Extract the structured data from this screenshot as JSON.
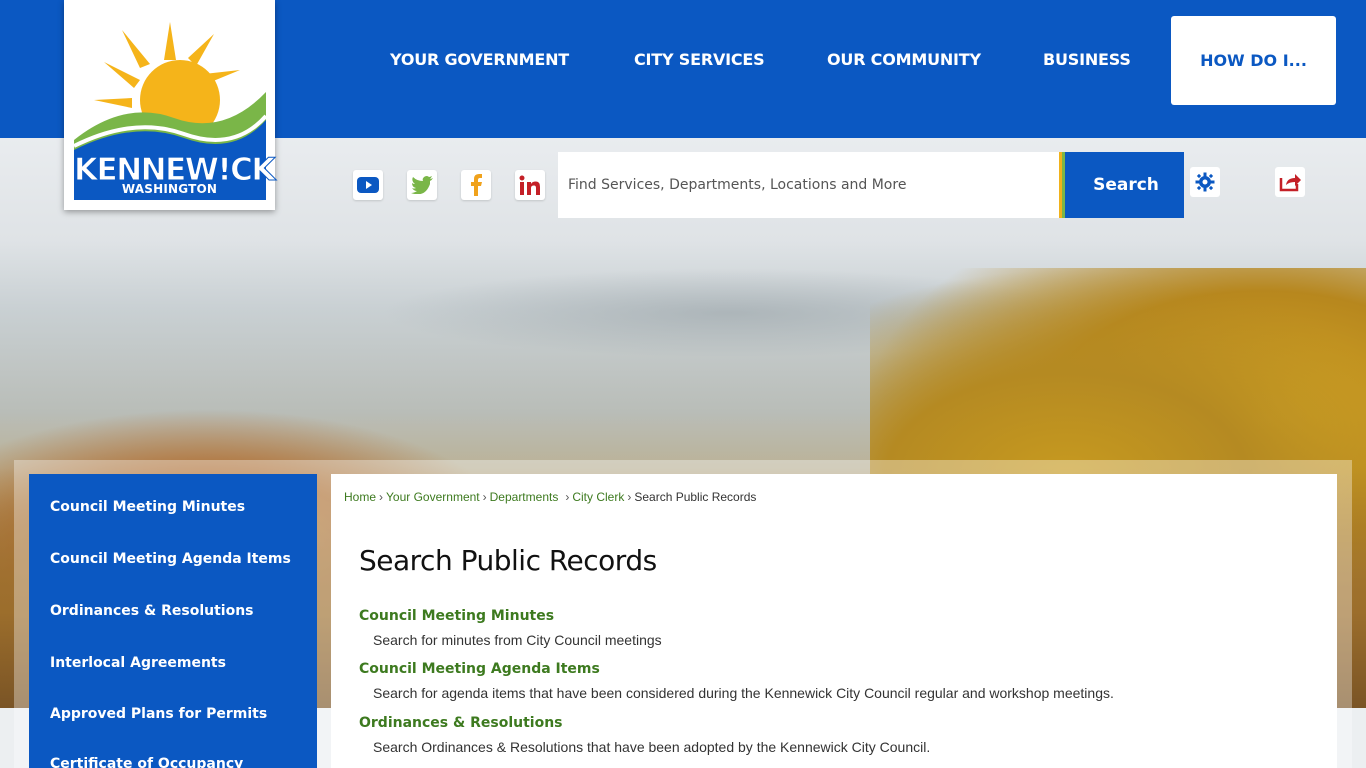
{
  "header": {
    "logo": {
      "name": "KENNEW!CK",
      "subtitle": "WASHINGTON"
    },
    "nav": {
      "items": [
        {
          "label": "YOUR GOVERNMENT"
        },
        {
          "label": "CITY SERVICES"
        },
        {
          "label": "OUR COMMUNITY"
        },
        {
          "label": "BUSINESS"
        },
        {
          "label": "HOW DO I..."
        }
      ]
    },
    "social": [
      {
        "name": "youtube-icon",
        "color": "#0b58c2"
      },
      {
        "name": "twitter-icon",
        "color": "#7ab648"
      },
      {
        "name": "facebook-icon",
        "color": "#f0a21c"
      },
      {
        "name": "linkedin-icon",
        "color": "#c42027"
      }
    ],
    "search": {
      "placeholder": "Find Services, Departments, Locations and More",
      "button_label": "Search"
    },
    "tools": {
      "settings_icon": "gear-icon",
      "share_icon": "share-icon"
    }
  },
  "sidebar": {
    "items": [
      {
        "label": "Council Meeting Minutes"
      },
      {
        "label": "Council Meeting Agenda Items"
      },
      {
        "label": "Ordinances & Resolutions"
      },
      {
        "label": "Interlocal Agreements"
      },
      {
        "label": "Approved Plans for Permits"
      },
      {
        "label": "Certificate of Occupancy"
      }
    ]
  },
  "breadcrumb": {
    "items": [
      "Home",
      "Your Government",
      "Departments",
      "City Clerk"
    ],
    "current": "Search Public Records"
  },
  "main": {
    "title": "Search Public Records",
    "records": [
      {
        "title": "Council Meeting Minutes",
        "description": "Search for minutes from City Council meetings"
      },
      {
        "title": "Council Meeting Agenda Items",
        "description": "Search for agenda items that have been considered during the Kennewick City Council regular and workshop meetings."
      },
      {
        "title": "Ordinances & Resolutions",
        "description": "Search Ordinances & Resolutions that have been adopted by the Kennewick City Council."
      }
    ]
  },
  "colors": {
    "brand_blue": "#0b58c2",
    "link_green": "#3d7a1f",
    "accent_gold": "#f0b21c",
    "accent_green": "#7ab648"
  }
}
